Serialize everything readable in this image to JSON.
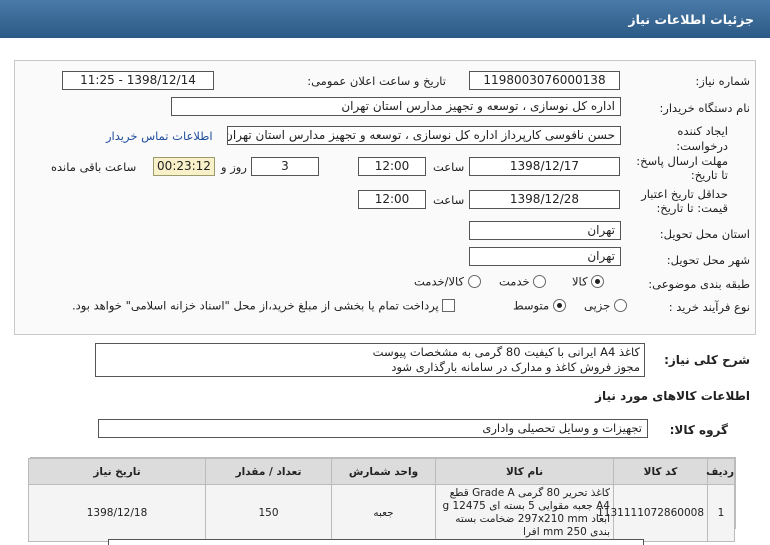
{
  "header": {
    "title": "جزئیات اطلاعات نیاز"
  },
  "need_number": {
    "label": "شماره نیاز:",
    "value": "1198003076000138"
  },
  "announce_date": {
    "label": "تاریخ و ساعت اعلان عمومی:",
    "value": "1398/12/14 - 11:25"
  },
  "buyer_org": {
    "label": "نام دستگاه خریدار:",
    "value": "اداره کل نوسازی ، توسعه و تجهیز مدارس استان تهران"
  },
  "requester": {
    "label_1": "ایجاد کننده",
    "label_2": "درخواست:",
    "value": "حسن نافوسی کارپرداز اداره کل نوسازی ، توسعه و تجهیز مدارس استان تهران",
    "contact_link": "اطلاعات تماس خریدار"
  },
  "reply_deadline": {
    "label_1": "مهلت ارسال پاسخ:",
    "label_2": "تا تاریخ:",
    "date": "1398/12/17",
    "time_label": "ساعت",
    "time": "12:00",
    "days": "3",
    "days_label": "روز و",
    "remaining": "00:23:12",
    "remaining_label": "ساعت باقی مانده"
  },
  "price_validity": {
    "label_1": "حداقل تاریخ اعتبار",
    "label_2": "قیمت: تا تاریخ:",
    "date": "1398/12/28",
    "time_label": "ساعت",
    "time": "12:00"
  },
  "delivery_province": {
    "label": "استان محل تحویل:",
    "value": "تهران"
  },
  "delivery_city": {
    "label": "شهر محل تحویل:",
    "value": "تهران"
  },
  "category": {
    "label": "طبقه بندی موضوعی:",
    "options": [
      "کالا",
      "خدمت",
      "کالا/خدمت"
    ],
    "selected": "کالا"
  },
  "purchase_process": {
    "label": "نوع فرآیند خرید :",
    "options": [
      "جزیی",
      "متوسط"
    ],
    "selected": "متوسط",
    "checkbox_text": "پرداخت تمام یا بخشی از مبلغ خرید،از محل \"اسناد خزانه اسلامی\" خواهد بود."
  },
  "description": {
    "label": "شرح کلی نیاز:",
    "line_1": "کاغذ A4 ایرانی با کیفیت 80 گرمی به مشخصات پیوست",
    "line_2": "مجوز فروش کاغذ و مدارک در سامانه بارگذاری شود"
  },
  "goods_info": {
    "title": "اطلاعات کالاهای مورد نیاز"
  },
  "goods_group": {
    "label": "گروه کالا:",
    "value": "تجهیزات و وسایل تحصیلی واداری"
  },
  "table": {
    "headers": [
      "ردیف",
      "کد کالا",
      "نام کالا",
      "واحد شمارش",
      "تعداد / مقدار",
      "تاریخ نیاز"
    ],
    "rows": [
      {
        "row": "1",
        "code": "1131111072860008",
        "name": "کاغذ تحریر 80 گرمی Grade A قطع A4 جعبه مقوایی 5 بسته ای 12475 g ابعاد 297x210 mm ضخامت بسته بندی 250 mm افرا",
        "unit": "جعبه",
        "qty": "150",
        "date": "1398/12/18"
      }
    ]
  }
}
